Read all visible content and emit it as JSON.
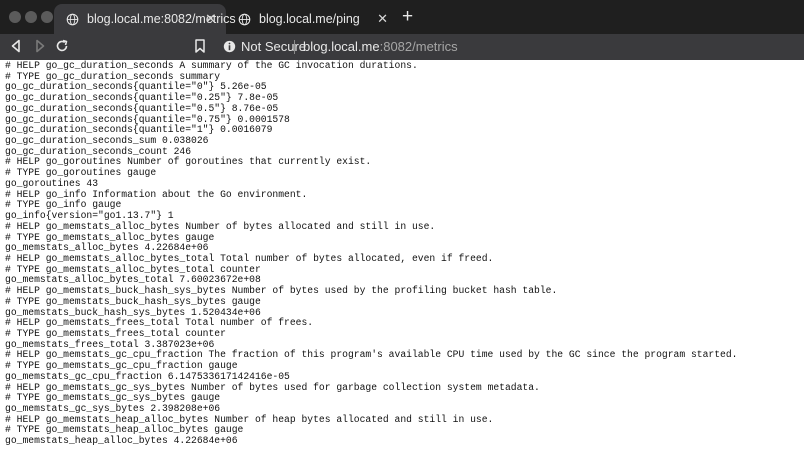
{
  "tabs": [
    {
      "title": "blog.local.me:8082/metrics",
      "active": true,
      "icon": "globe-icon"
    },
    {
      "title": "blog.local.me/ping",
      "active": false,
      "icon": "globe-icon"
    }
  ],
  "toolbar": {
    "security_label": "Not Secure",
    "url_host": "blog.local.me",
    "url_rest": ":8082/metrics"
  },
  "colors": {
    "tabstrip": "#1f1f1f",
    "toolbar": "#3a3a3d",
    "page_background": "#ffffff",
    "text": "#111111"
  },
  "lines": [
    "# HELP go_gc_duration_seconds A summary of the GC invocation durations.",
    "# TYPE go_gc_duration_seconds summary",
    "go_gc_duration_seconds{quantile=\"0\"} 5.26e-05",
    "go_gc_duration_seconds{quantile=\"0.25\"} 7.8e-05",
    "go_gc_duration_seconds{quantile=\"0.5\"} 8.76e-05",
    "go_gc_duration_seconds{quantile=\"0.75\"} 0.0001578",
    "go_gc_duration_seconds{quantile=\"1\"} 0.0016079",
    "go_gc_duration_seconds_sum 0.038026",
    "go_gc_duration_seconds_count 246",
    "# HELP go_goroutines Number of goroutines that currently exist.",
    "# TYPE go_goroutines gauge",
    "go_goroutines 43",
    "# HELP go_info Information about the Go environment.",
    "# TYPE go_info gauge",
    "go_info{version=\"go1.13.7\"} 1",
    "# HELP go_memstats_alloc_bytes Number of bytes allocated and still in use.",
    "# TYPE go_memstats_alloc_bytes gauge",
    "go_memstats_alloc_bytes 4.22684e+06",
    "# HELP go_memstats_alloc_bytes_total Total number of bytes allocated, even if freed.",
    "# TYPE go_memstats_alloc_bytes_total counter",
    "go_memstats_alloc_bytes_total 7.60023672e+08",
    "# HELP go_memstats_buck_hash_sys_bytes Number of bytes used by the profiling bucket hash table.",
    "# TYPE go_memstats_buck_hash_sys_bytes gauge",
    "go_memstats_buck_hash_sys_bytes 1.520434e+06",
    "# HELP go_memstats_frees_total Total number of frees.",
    "# TYPE go_memstats_frees_total counter",
    "go_memstats_frees_total 3.387023e+06",
    "# HELP go_memstats_gc_cpu_fraction The fraction of this program's available CPU time used by the GC since the program started.",
    "# TYPE go_memstats_gc_cpu_fraction gauge",
    "go_memstats_gc_cpu_fraction 6.147533617142416e-05",
    "# HELP go_memstats_gc_sys_bytes Number of bytes used for garbage collection system metadata.",
    "# TYPE go_memstats_gc_sys_bytes gauge",
    "go_memstats_gc_sys_bytes 2.398208e+06",
    "# HELP go_memstats_heap_alloc_bytes Number of heap bytes allocated and still in use.",
    "# TYPE go_memstats_heap_alloc_bytes gauge",
    "go_memstats_heap_alloc_bytes 4.22684e+06"
  ]
}
